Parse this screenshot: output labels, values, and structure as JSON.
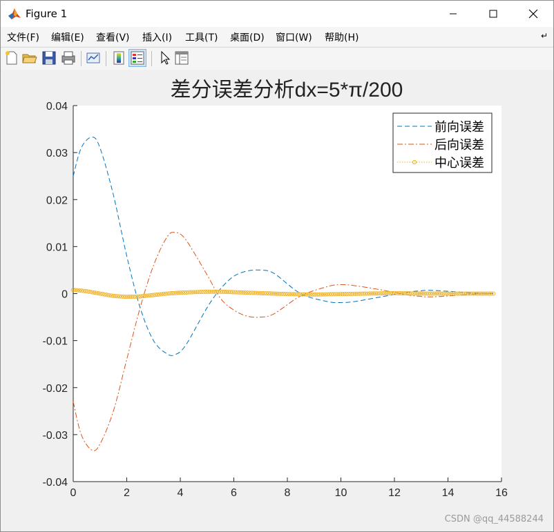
{
  "window": {
    "title": "Figure 1"
  },
  "menu": [
    {
      "label": "文件(F)"
    },
    {
      "label": "编辑(E)"
    },
    {
      "label": "查看(V)"
    },
    {
      "label": "插入(I)"
    },
    {
      "label": "工具(T)"
    },
    {
      "label": "桌面(D)"
    },
    {
      "label": "窗口(W)"
    },
    {
      "label": "帮助(H)"
    }
  ],
  "toolbar": {
    "icons": [
      "new-figure-icon",
      "open-file-icon",
      "save-icon",
      "print-icon",
      "link-plot-icon",
      "colorbar-icon",
      "legend-icon",
      "pointer-icon",
      "property-inspector-icon"
    ]
  },
  "chart_data": {
    "type": "line",
    "title": "差分误差分析dx=5*π/200",
    "xlim": [
      0,
      16
    ],
    "ylim": [
      -0.04,
      0.04
    ],
    "xticks": [
      "0",
      "2",
      "4",
      "6",
      "8",
      "10",
      "12",
      "14",
      "16"
    ],
    "yticks": [
      "0.04",
      "0.03",
      "0.02",
      "0.01",
      "0",
      "-0.01",
      "-0.02",
      "-0.03",
      "-0.04"
    ],
    "legend_position": "top-right",
    "grid": false,
    "series": [
      {
        "name": "前向误差",
        "style": "dashed",
        "color": "#0072bd",
        "points": [
          [
            0,
            0.025
          ],
          [
            0.3,
            0.031
          ],
          [
            0.7,
            0.0333
          ],
          [
            1.0,
            0.031
          ],
          [
            1.5,
            0.021
          ],
          [
            2.0,
            0.008
          ],
          [
            2.5,
            -0.003
          ],
          [
            3.0,
            -0.01
          ],
          [
            3.5,
            -0.0128
          ],
          [
            3.8,
            -0.013
          ],
          [
            4.2,
            -0.011
          ],
          [
            5.0,
            -0.003
          ],
          [
            5.5,
            0.001
          ],
          [
            6.0,
            0.0037
          ],
          [
            6.5,
            0.0048
          ],
          [
            7.0,
            0.005
          ],
          [
            7.5,
            0.0043
          ],
          [
            8.5,
            0.0
          ],
          [
            9.5,
            -0.0017
          ],
          [
            10.0,
            -0.0019
          ],
          [
            10.5,
            -0.0017
          ],
          [
            11.5,
            -0.0007
          ],
          [
            12.5,
            0.0003
          ],
          [
            13.0,
            0.0006
          ],
          [
            13.3,
            0.0007
          ],
          [
            14.0,
            0.0005
          ],
          [
            15.0,
            0.0001
          ],
          [
            15.7,
            0.0
          ]
        ]
      },
      {
        "name": "后向误差",
        "style": "dash-dot",
        "color": "#d95319",
        "points": [
          [
            0,
            -0.023
          ],
          [
            0.3,
            -0.03
          ],
          [
            0.7,
            -0.0333
          ],
          [
            1.0,
            -0.032
          ],
          [
            1.5,
            -0.025
          ],
          [
            2.0,
            -0.014
          ],
          [
            2.5,
            -0.003
          ],
          [
            3.0,
            0.006
          ],
          [
            3.5,
            0.012
          ],
          [
            3.8,
            0.013
          ],
          [
            4.2,
            0.0115
          ],
          [
            5.0,
            0.004
          ],
          [
            5.5,
            -0.001
          ],
          [
            6.0,
            -0.0035
          ],
          [
            6.5,
            -0.0048
          ],
          [
            7.0,
            -0.005
          ],
          [
            7.5,
            -0.0043
          ],
          [
            8.5,
            -0.0005
          ],
          [
            9.5,
            0.0015
          ],
          [
            10.0,
            0.0019
          ],
          [
            10.5,
            0.0017
          ],
          [
            11.5,
            0.0008
          ],
          [
            12.5,
            -0.0003
          ],
          [
            13.0,
            -0.0006
          ],
          [
            13.3,
            -0.0007
          ],
          [
            14.0,
            -0.0005
          ],
          [
            15.0,
            -0.0001
          ],
          [
            15.7,
            0.0
          ]
        ]
      },
      {
        "name": "中心误差",
        "style": "dotted-circle-markers",
        "color": "#edb120",
        "points": [
          [
            0,
            0.0008
          ],
          [
            0.5,
            0.0005
          ],
          [
            1.0,
            0.0
          ],
          [
            1.5,
            -0.0005
          ],
          [
            2.0,
            -0.0007
          ],
          [
            2.5,
            -0.0006
          ],
          [
            3.0,
            -0.0003
          ],
          [
            3.5,
            0.0
          ],
          [
            4.0,
            0.0002
          ],
          [
            5.0,
            0.0004
          ],
          [
            5.5,
            0.0004
          ],
          [
            6.0,
            0.0003
          ],
          [
            7.0,
            0.0001
          ],
          [
            8.0,
            -0.0001
          ],
          [
            9.0,
            -0.0002
          ],
          [
            10.0,
            -0.0001
          ],
          [
            11.0,
            0.0
          ],
          [
            12.0,
            0.0001
          ],
          [
            13.0,
            0.0
          ],
          [
            14.0,
            0.0
          ],
          [
            15.7,
            0.0
          ]
        ]
      }
    ]
  },
  "watermark": "CSDN @qq_44588244"
}
